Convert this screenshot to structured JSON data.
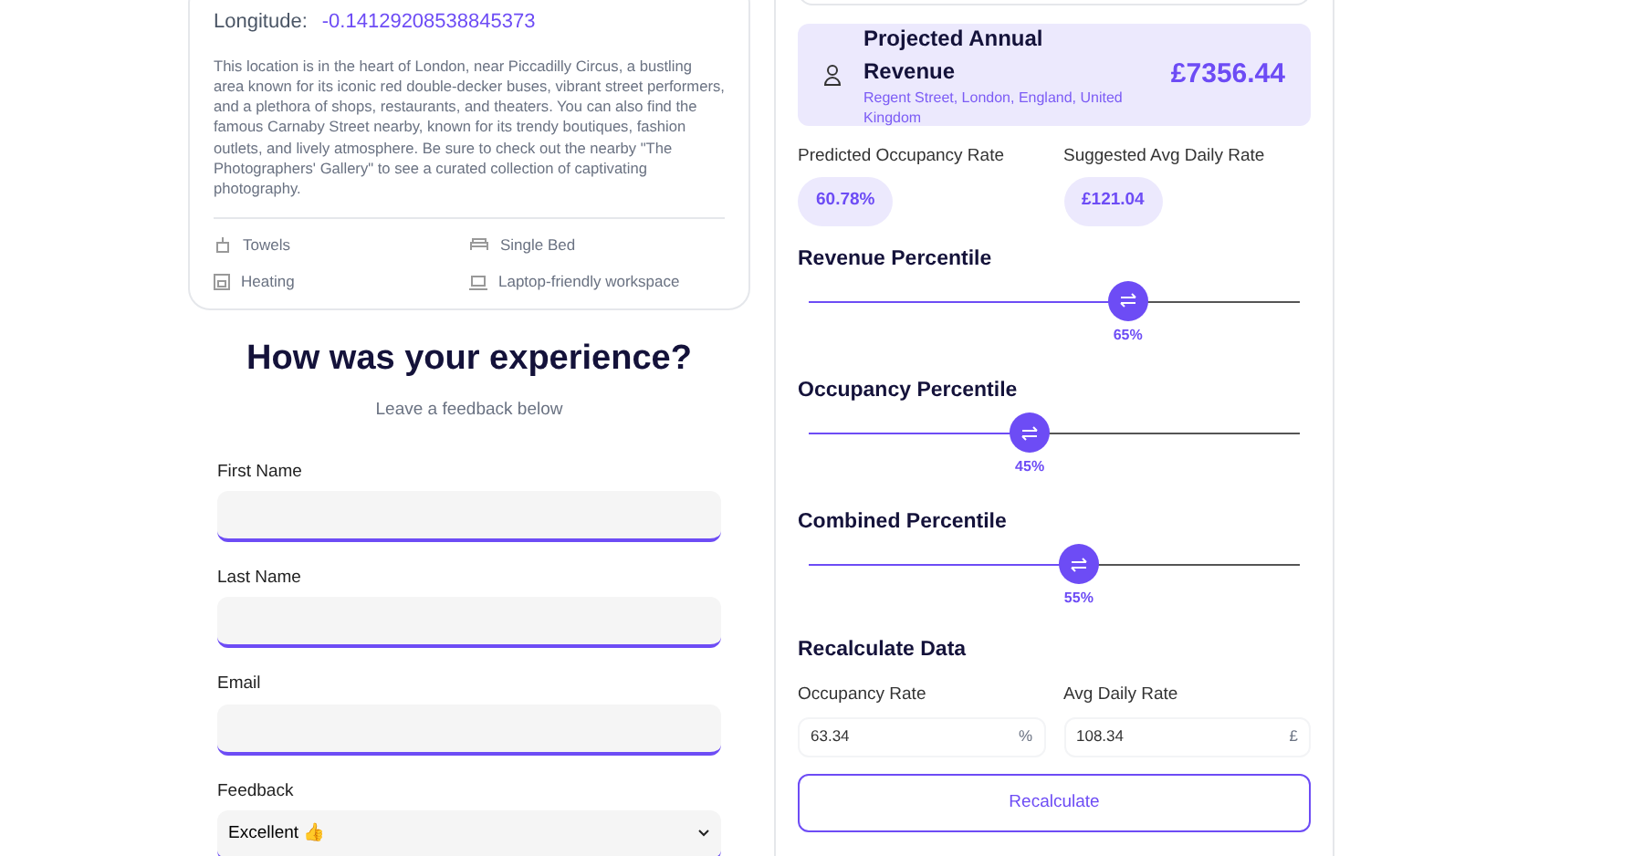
{
  "location_card": {
    "longitude_label": "Longitude:",
    "longitude": "-0.14129208538845373",
    "description": "This location is in the heart of London, near Piccadilly Circus, a bustling area known for its iconic red double-decker buses, vibrant street performers, and a plethora of shops, restaurants, and theaters. You can also find the famous Carnaby Street nearby, known for its trendy boutiques, fashion outlets, and lively atmosphere. Be sure to check out the nearby \"The Photographers' Gallery\" to see a curated collection of captivating photography.",
    "amenities": [
      {
        "kind": "towels",
        "label": "Towels"
      },
      {
        "kind": "bed",
        "label": "Single Bed"
      },
      {
        "kind": "heating",
        "label": "Heating"
      },
      {
        "kind": "laptop",
        "label": "Laptop-friendly workspace"
      }
    ]
  },
  "feedback_form": {
    "title": "How was your experience?",
    "subtitle": "Leave a feedback below",
    "fields": [
      {
        "label": "First Name"
      },
      {
        "label": "Last Name"
      },
      {
        "label": "Email"
      }
    ],
    "feedback_label": "Feedback",
    "feedback_value": "Excellent 👍"
  },
  "revenue": {
    "title": "Projected Annual Revenue",
    "address": "Regent Street, London, England, United Kingdom",
    "amount": "£7356.44"
  },
  "rates": [
    {
      "label": "Predicted Occupancy Rate",
      "value": "60.78%"
    },
    {
      "label": "Suggested Avg Daily Rate",
      "value": "£121.04"
    }
  ],
  "percentiles": [
    {
      "title": "Revenue Percentile",
      "level": 0.65,
      "reading": "65%"
    },
    {
      "title": "Occupancy Percentile",
      "level": 0.45,
      "reading": "45%"
    },
    {
      "title": "Combined Percentile",
      "level": 0.55,
      "reading": "55%"
    }
  ],
  "recalculate": {
    "title": "Recalculate Data",
    "inputs": [
      {
        "label": "Occupancy Rate",
        "value": "63.34",
        "unit": "%"
      },
      {
        "label": "Avg Daily Rate",
        "value": "108.34",
        "unit": "£"
      }
    ],
    "button": "Recalculate"
  }
}
